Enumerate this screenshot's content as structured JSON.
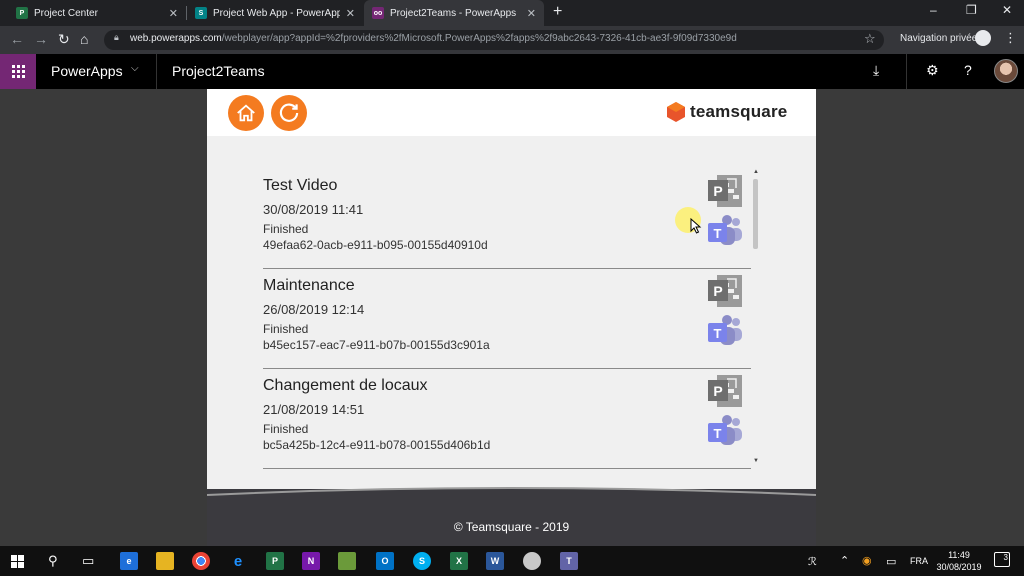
{
  "browser": {
    "tabs": [
      {
        "title": "Project Center",
        "fav": "P",
        "fav_color": "#217346"
      },
      {
        "title": "Project Web App - PowerApp_Da",
        "fav": "S",
        "fav_color": "#038387"
      },
      {
        "title": "Project2Teams - PowerApps",
        "fav": "oo",
        "fav_color": "#742774"
      }
    ],
    "new_tab": "+",
    "window_controls": {
      "minimize": "–",
      "maximize": "❐",
      "close": "✕"
    },
    "url_host": "web.powerapps.com",
    "url_path": "/webplayer/app?appId=%2fproviders%2fMicrosoft.PowerApps%2fapps%2f9abc2643-7326-41cb-ae3f-9f09d7330e9d",
    "incognito_label": "Navigation privée"
  },
  "powerapps": {
    "brand": "PowerApps",
    "app_name": "Project2Teams"
  },
  "app": {
    "logo_text": "teamsquare",
    "accent": "#f47b20",
    "projects": [
      {
        "title": "Test Video",
        "date": "30/08/2019 11:41",
        "status": "Finished",
        "id": "49efaa62-0acb-e911-b095-00155d40910d"
      },
      {
        "title": "Maintenance",
        "date": "26/08/2019 12:14",
        "status": "Finished",
        "id": "b45ec157-eac7-e911-b07b-00155d3c901a"
      },
      {
        "title": "Changement de locaux",
        "date": "21/08/2019 14:51",
        "status": "Finished",
        "id": "bc5a425b-12c4-e911-b078-00155d406b1d"
      }
    ],
    "footer": "© Teamsquare - 2019"
  },
  "taskbar": {
    "language": "FRA",
    "time": "11:49",
    "date": "30/08/2019",
    "notifications": "3"
  }
}
